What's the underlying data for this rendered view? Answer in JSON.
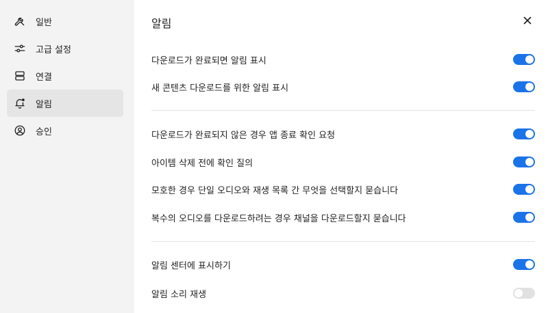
{
  "sidebar": {
    "items": [
      {
        "label": "일반",
        "icon": "wrench-icon"
      },
      {
        "label": "고급 설정",
        "icon": "sliders-icon"
      },
      {
        "label": "연결",
        "icon": "server-icon"
      },
      {
        "label": "알림",
        "icon": "bell-icon"
      },
      {
        "label": "승인",
        "icon": "user-circle-icon"
      }
    ],
    "active_index": 3
  },
  "panel": {
    "title": "알림",
    "close_icon": "close-icon"
  },
  "settings": [
    {
      "label": "다운로드가 완료되면 알림 표시",
      "enabled": true
    },
    {
      "label": "새 콘텐츠 다운로드를 위한 알림 표시",
      "enabled": true
    },
    {
      "label": "다운로드가 완료되지 않은 경우 앱 종료 확인 요청",
      "enabled": true
    },
    {
      "label": "아이템 삭제 전에 확인 질의",
      "enabled": true
    },
    {
      "label": "모호한 경우 단일 오디오와 재생 목록 간 무엇을 선택할지 묻습니다",
      "enabled": true
    },
    {
      "label": "복수의 오디오를 다운로드하려는 경우 채널을 다운로드할지 묻습니다",
      "enabled": true
    },
    {
      "label": "알림 센터에 표시하기",
      "enabled": true
    },
    {
      "label": "알림 소리 재생",
      "enabled": false
    }
  ],
  "colors": {
    "accent": "#1a73e8",
    "toggle_off": "#e1e1e1",
    "sidebar_bg": "#f3f3f3",
    "sidebar_active": "#e5e5e5"
  }
}
